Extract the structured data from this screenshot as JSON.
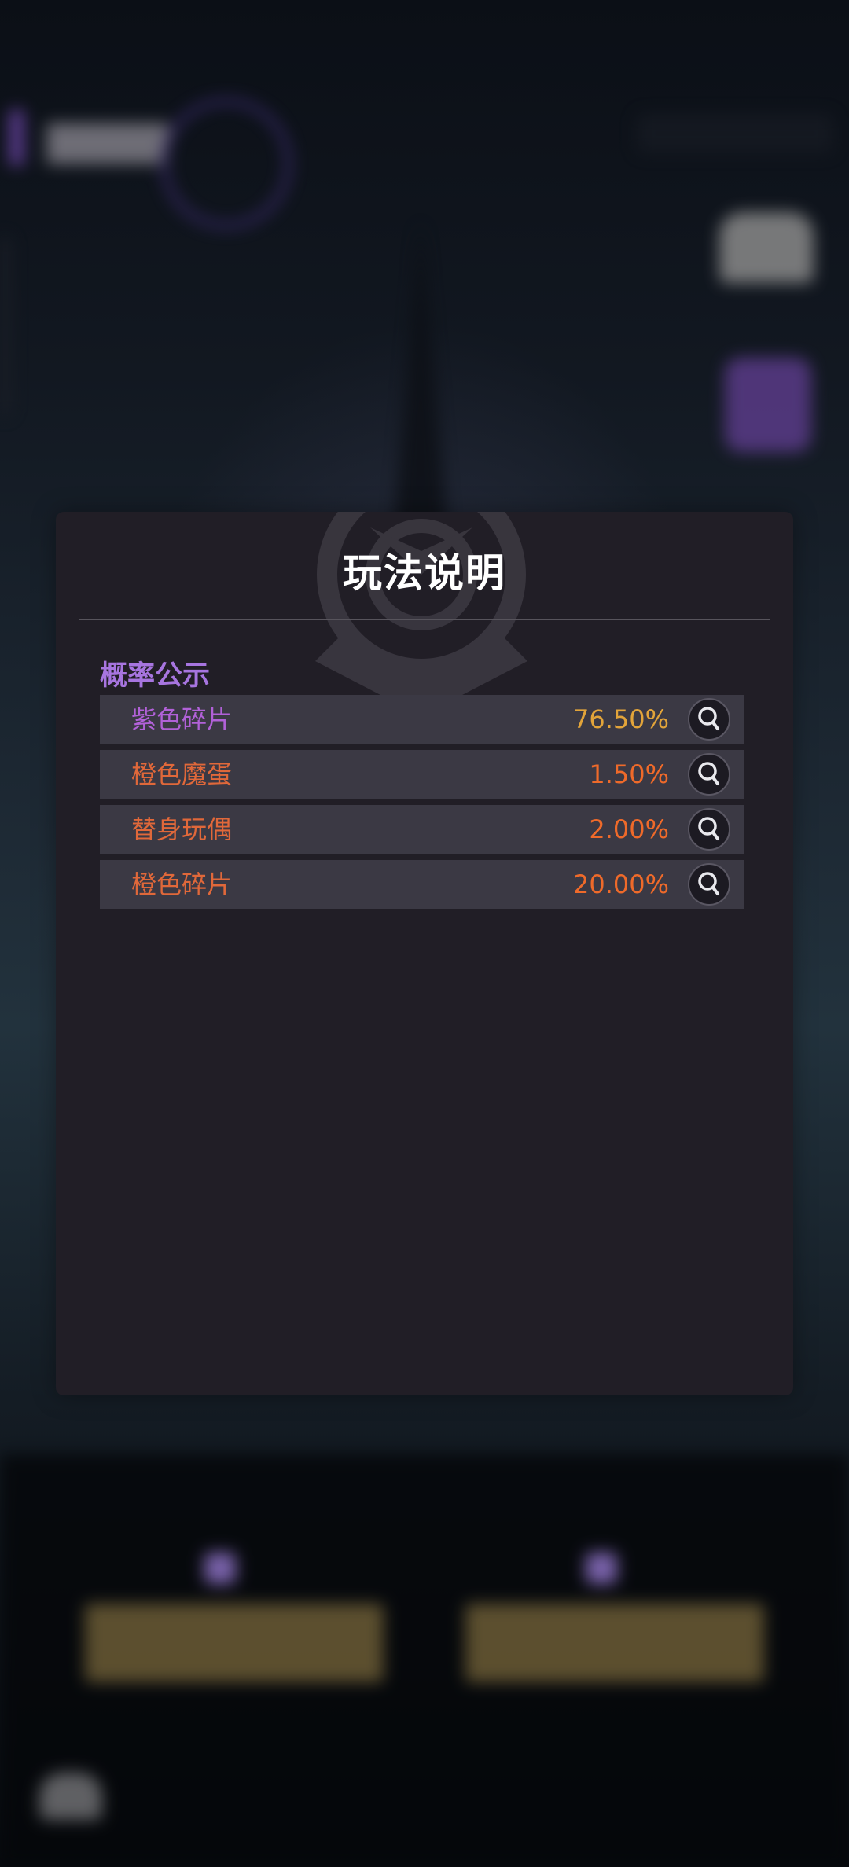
{
  "modal": {
    "title": "玩法说明",
    "section_title": "概率公示",
    "rows": [
      {
        "name": "紫色碎片",
        "value": "76.50%",
        "name_color": "#b161d8",
        "value_color": "#e2a43a",
        "icon": "magnifier-icon"
      },
      {
        "name": "橙色魔蛋",
        "value": "1.50%",
        "name_color": "#e0683a",
        "value_color": "#ef6a2a",
        "icon": "magnifier-icon"
      },
      {
        "name": "替身玩偶",
        "value": "2.00%",
        "name_color": "#e0683a",
        "value_color": "#ef6a2a",
        "icon": "magnifier-icon"
      },
      {
        "name": "橙色碎片",
        "value": "20.00%",
        "name_color": "#e0683a",
        "value_color": "#ef6a2a",
        "icon": "magnifier-icon"
      }
    ]
  },
  "colors": {
    "modal_bg": "#211e26",
    "row_bg": "#3b3944",
    "section_title": "#a775e0"
  }
}
